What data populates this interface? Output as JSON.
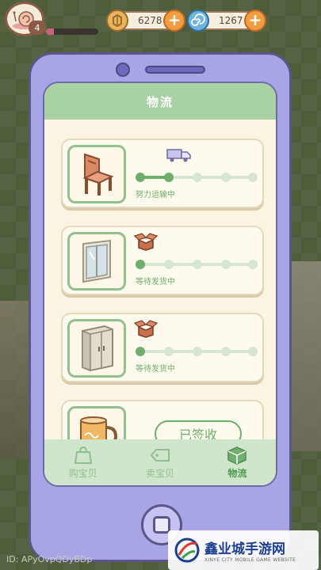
{
  "player": {
    "level": "4",
    "xp_fraction": 0.15,
    "id_label": "ID: APyOvpQDyBDp"
  },
  "currencies": [
    {
      "icon": "coin-icon",
      "value": "6278"
    },
    {
      "icon": "swirl-gem-icon",
      "value": "1267"
    }
  ],
  "screen": {
    "title": "物流"
  },
  "orders": [
    {
      "item": "chair",
      "status_icon": "delivery-truck-icon",
      "status": "努力运输中",
      "progress_step": 2
    },
    {
      "item": "window",
      "status_icon": "open-box-icon",
      "status": "等待发货中",
      "progress_step": 1
    },
    {
      "item": "wardrobe",
      "status_icon": "open-box-icon",
      "status": "等待发货中",
      "progress_step": 1
    },
    {
      "item": "mug",
      "button": "已签收"
    }
  ],
  "nav": [
    {
      "label": "购宝贝",
      "icon": "shopping-bag-icon"
    },
    {
      "label": "卖宝贝",
      "icon": "price-tag-icon"
    },
    {
      "label": "物流",
      "icon": "package-box-icon"
    }
  ],
  "watermark": {
    "title": "鑫业城手游网",
    "subtitle": "XINYE CITY MOBILE GAME WEBSITE"
  },
  "colors": {
    "accent_green": "#6fae6c",
    "phone_body": "#a8a5e6",
    "header_green": "#a8d2a4"
  }
}
